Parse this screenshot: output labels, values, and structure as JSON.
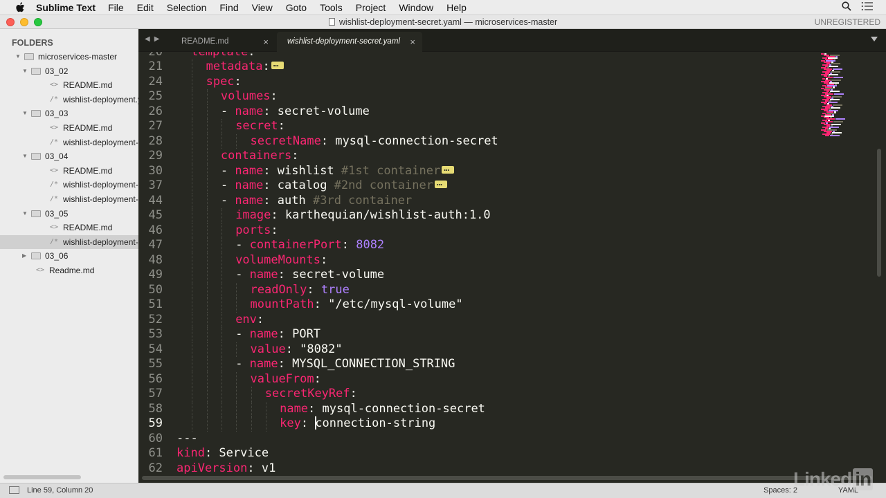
{
  "menubar": {
    "app_name": "Sublime Text",
    "items": [
      "File",
      "Edit",
      "Selection",
      "Find",
      "View",
      "Goto",
      "Tools",
      "Project",
      "Window",
      "Help"
    ]
  },
  "window": {
    "title": "wishlist-deployment-secret.yaml — microservices-master",
    "license": "UNREGISTERED"
  },
  "sidebar": {
    "title": "FOLDERS",
    "tree": [
      {
        "label": "microservices-master",
        "type": "folder",
        "depth": 0,
        "open": true
      },
      {
        "label": "03_02",
        "type": "folder",
        "depth": 1,
        "open": true
      },
      {
        "label": "README.md",
        "type": "file",
        "icon": "<>",
        "depth": 2
      },
      {
        "label": "wishlist-deployment.yaml",
        "type": "file",
        "icon": "/*",
        "depth": 2
      },
      {
        "label": "03_03",
        "type": "folder",
        "depth": 1,
        "open": true
      },
      {
        "label": "README.md",
        "type": "file",
        "icon": "<>",
        "depth": 2
      },
      {
        "label": "wishlist-deployment-alternate.yaml",
        "type": "file",
        "icon": "/*",
        "depth": 2
      },
      {
        "label": "03_04",
        "type": "folder",
        "depth": 1,
        "open": true
      },
      {
        "label": "README.md",
        "type": "file",
        "icon": "<>",
        "depth": 2
      },
      {
        "label": "wishlist-deployment-configmap.yaml",
        "type": "file",
        "icon": "/*",
        "depth": 2
      },
      {
        "label": "wishlist-deployment-configmap-env.yaml",
        "type": "file",
        "icon": "/*",
        "depth": 2
      },
      {
        "label": "03_05",
        "type": "folder",
        "depth": 1,
        "open": true
      },
      {
        "label": "README.md",
        "type": "file",
        "icon": "<>",
        "depth": 2
      },
      {
        "label": "wishlist-deployment-secret.yaml",
        "type": "file",
        "icon": "/*",
        "depth": 2,
        "selected": true
      },
      {
        "label": "03_06",
        "type": "folder",
        "depth": 1,
        "open": false
      },
      {
        "label": "Readme.md",
        "type": "file",
        "icon": "<>",
        "depth": 1
      }
    ]
  },
  "tabs": [
    {
      "label": "README.md",
      "active": false,
      "close": "×"
    },
    {
      "label": "wishlist-deployment-secret.yaml",
      "active": true,
      "close": "×"
    }
  ],
  "editor": {
    "current_line": "59",
    "lines": [
      {
        "n": "20",
        "indent": 1,
        "tokens": [
          {
            "t": "template",
            "c": "k"
          },
          {
            "t": ":",
            "c": "s"
          }
        ]
      },
      {
        "n": "21",
        "indent": 2,
        "tokens": [
          {
            "t": "metadata",
            "c": "k"
          },
          {
            "t": ":",
            "c": "s"
          }
        ],
        "fold": true
      },
      {
        "n": "24",
        "indent": 2,
        "tokens": [
          {
            "t": "spec",
            "c": "k"
          },
          {
            "t": ":",
            "c": "s"
          }
        ]
      },
      {
        "n": "25",
        "indent": 3,
        "tokens": [
          {
            "t": "volumes",
            "c": "k"
          },
          {
            "t": ":",
            "c": "s"
          }
        ]
      },
      {
        "n": "26",
        "indent": 3,
        "tokens": [
          {
            "t": "- ",
            "c": "s"
          },
          {
            "t": "name",
            "c": "k"
          },
          {
            "t": ": secret-volume",
            "c": "s"
          }
        ]
      },
      {
        "n": "27",
        "indent": 4,
        "tokens": [
          {
            "t": "secret",
            "c": "k"
          },
          {
            "t": ":",
            "c": "s"
          }
        ]
      },
      {
        "n": "28",
        "indent": 5,
        "tokens": [
          {
            "t": "secretName",
            "c": "k"
          },
          {
            "t": ": mysql-connection-secret",
            "c": "s"
          }
        ]
      },
      {
        "n": "29",
        "indent": 3,
        "tokens": [
          {
            "t": "containers",
            "c": "k"
          },
          {
            "t": ":",
            "c": "s"
          }
        ]
      },
      {
        "n": "30",
        "indent": 3,
        "tokens": [
          {
            "t": "- ",
            "c": "s"
          },
          {
            "t": "name",
            "c": "k"
          },
          {
            "t": ": wishlist ",
            "c": "s"
          },
          {
            "t": "#1st container",
            "c": "c"
          }
        ],
        "fold": true
      },
      {
        "n": "37",
        "indent": 3,
        "tokens": [
          {
            "t": "- ",
            "c": "s"
          },
          {
            "t": "name",
            "c": "k"
          },
          {
            "t": ": catalog ",
            "c": "s"
          },
          {
            "t": "#2nd container",
            "c": "c"
          }
        ],
        "fold": true
      },
      {
        "n": "44",
        "indent": 3,
        "tokens": [
          {
            "t": "- ",
            "c": "s"
          },
          {
            "t": "name",
            "c": "k"
          },
          {
            "t": ": auth ",
            "c": "s"
          },
          {
            "t": "#3rd container",
            "c": "c"
          }
        ]
      },
      {
        "n": "45",
        "indent": 4,
        "tokens": [
          {
            "t": "image",
            "c": "k"
          },
          {
            "t": ": karthequian/wishlist-auth:1.0",
            "c": "s"
          }
        ]
      },
      {
        "n": "46",
        "indent": 4,
        "tokens": [
          {
            "t": "ports",
            "c": "k"
          },
          {
            "t": ":",
            "c": "s"
          }
        ]
      },
      {
        "n": "47",
        "indent": 4,
        "tokens": [
          {
            "t": "- ",
            "c": "s"
          },
          {
            "t": "containerPort",
            "c": "k"
          },
          {
            "t": ": ",
            "c": "s"
          },
          {
            "t": "8082",
            "c": "n"
          }
        ]
      },
      {
        "n": "48",
        "indent": 4,
        "tokens": [
          {
            "t": "volumeMounts",
            "c": "k"
          },
          {
            "t": ":",
            "c": "s"
          }
        ]
      },
      {
        "n": "49",
        "indent": 4,
        "tokens": [
          {
            "t": "- ",
            "c": "s"
          },
          {
            "t": "name",
            "c": "k"
          },
          {
            "t": ": secret-volume",
            "c": "s"
          }
        ]
      },
      {
        "n": "50",
        "indent": 5,
        "tokens": [
          {
            "t": "readOnly",
            "c": "k"
          },
          {
            "t": ": ",
            "c": "s"
          },
          {
            "t": "true",
            "c": "n"
          }
        ]
      },
      {
        "n": "51",
        "indent": 5,
        "tokens": [
          {
            "t": "mountPath",
            "c": "k"
          },
          {
            "t": ": \"/etc/mysql-volume\"",
            "c": "s"
          }
        ]
      },
      {
        "n": "52",
        "indent": 4,
        "tokens": [
          {
            "t": "env",
            "c": "k"
          },
          {
            "t": ":",
            "c": "s"
          }
        ]
      },
      {
        "n": "53",
        "indent": 4,
        "tokens": [
          {
            "t": "- ",
            "c": "s"
          },
          {
            "t": "name",
            "c": "k"
          },
          {
            "t": ": PORT",
            "c": "s"
          }
        ]
      },
      {
        "n": "54",
        "indent": 5,
        "tokens": [
          {
            "t": "value",
            "c": "k"
          },
          {
            "t": ": \"8082\"",
            "c": "s"
          }
        ]
      },
      {
        "n": "55",
        "indent": 4,
        "tokens": [
          {
            "t": "- ",
            "c": "s"
          },
          {
            "t": "name",
            "c": "k"
          },
          {
            "t": ": MYSQL_CONNECTION_STRING",
            "c": "s"
          }
        ]
      },
      {
        "n": "56",
        "indent": 5,
        "tokens": [
          {
            "t": "valueFrom",
            "c": "k"
          },
          {
            "t": ":",
            "c": "s"
          }
        ]
      },
      {
        "n": "57",
        "indent": 6,
        "tokens": [
          {
            "t": "secretKeyRef",
            "c": "k"
          },
          {
            "t": ":",
            "c": "s"
          }
        ]
      },
      {
        "n": "58",
        "indent": 7,
        "tokens": [
          {
            "t": "name",
            "c": "k"
          },
          {
            "t": ": mysql-connection-secret",
            "c": "s"
          }
        ]
      },
      {
        "n": "59",
        "indent": 7,
        "tokens": [
          {
            "t": "key",
            "c": "k"
          },
          {
            "t": ": ",
            "c": "s"
          },
          {
            "t": "|",
            "c": "caret"
          },
          {
            "t": "connection-string",
            "c": "s"
          }
        ]
      },
      {
        "n": "60",
        "indent": 0,
        "tokens": [
          {
            "t": "---",
            "c": "s"
          }
        ]
      },
      {
        "n": "61",
        "indent": 0,
        "tokens": [
          {
            "t": "kind",
            "c": "k"
          },
          {
            "t": ": Service",
            "c": "s"
          }
        ]
      },
      {
        "n": "62",
        "indent": 0,
        "tokens": [
          {
            "t": "apiVersion",
            "c": "k"
          },
          {
            "t": ": v1",
            "c": "s"
          }
        ]
      }
    ]
  },
  "statusbar": {
    "position": "Line 59, Column 20",
    "indentation": "Spaces: 2",
    "syntax": "YAML"
  },
  "watermark": {
    "text": "Linked",
    "badge": "in"
  },
  "colors": {
    "editor_bg": "#272822",
    "keyword": "#f92672",
    "comment": "#75715e",
    "number": "#ae81ff",
    "text": "#f8f8f2"
  }
}
